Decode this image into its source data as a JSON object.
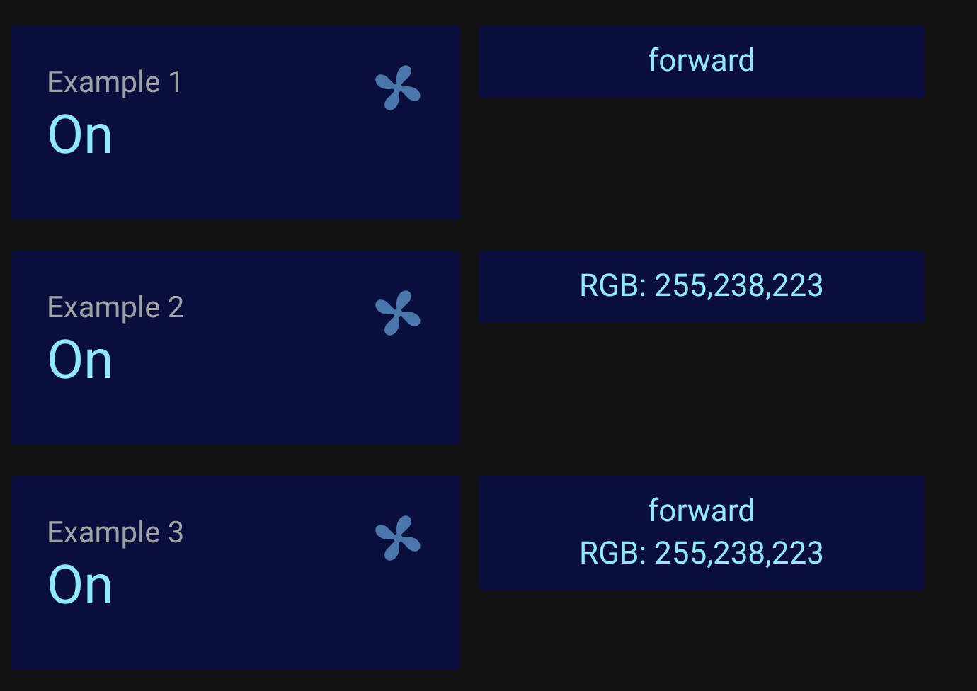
{
  "rows": [
    {
      "title": "Example 1",
      "state": "On",
      "attributes": [
        "forward"
      ]
    },
    {
      "title": "Example 2",
      "state": "On",
      "attributes": [
        "RGB: 255,238,223"
      ]
    },
    {
      "title": "Example 3",
      "state": "On",
      "attributes": [
        "forward",
        "RGB: 255,238,223"
      ]
    }
  ]
}
